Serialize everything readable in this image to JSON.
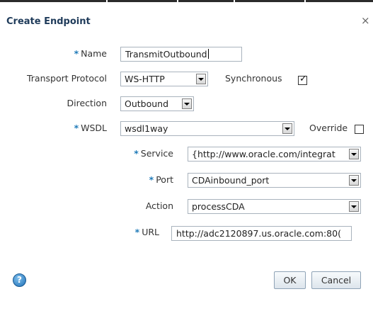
{
  "dialog": {
    "title": "Create Endpoint",
    "close_glyph": "×",
    "required_marker": "*"
  },
  "form": {
    "name": {
      "label": "Name",
      "value": "TransmitOutbound"
    },
    "transport_protocol": {
      "label": "Transport Protocol",
      "value": "WS-HTTP"
    },
    "synchronous": {
      "label": "Synchronous",
      "checked": true
    },
    "direction": {
      "label": "Direction",
      "value": "Outbound"
    },
    "wsdl": {
      "label": "WSDL",
      "value": "wsdl1way"
    },
    "override": {
      "label": "Override",
      "checked": false
    },
    "service": {
      "label": "Service",
      "value": "{http://www.oracle.com/integrat"
    },
    "port": {
      "label": "Port",
      "value": "CDAinbound_port"
    },
    "action": {
      "label": "Action",
      "value": "processCDA"
    },
    "url": {
      "label": "URL",
      "value": "http://adc2120897.us.oracle.com:80("
    }
  },
  "footer": {
    "help_glyph": "?",
    "ok_label": "OK",
    "cancel_label": "Cancel"
  },
  "icons": {
    "help": "help-icon",
    "close": "close-icon",
    "dropdown": "chevron-down-icon",
    "check": "checkmark-icon"
  },
  "colors": {
    "title": "#1f3b5a",
    "required": "#1f7ab8",
    "help": "#1f6fb5"
  }
}
